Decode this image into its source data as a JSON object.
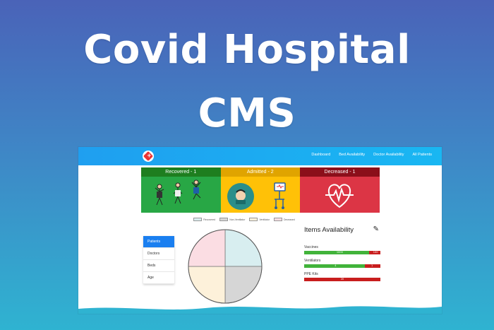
{
  "headline": {
    "line1": "Covid Hospital",
    "line2": "CMS"
  },
  "nav": {
    "logo_icon": "heart-cross-icon",
    "links": [
      "Dashboard",
      "Bed Availability",
      "Doctor Availability",
      "All Patients"
    ]
  },
  "cards": [
    {
      "title": "Recovered - 1",
      "color": "#28a745",
      "icon": "people-jumping-icon"
    },
    {
      "title": "Admitted - 2",
      "color": "#ffc107",
      "icon": "patient-ventilator-icon"
    },
    {
      "title": "Decreased - 1",
      "color": "#dc3545",
      "icon": "heartbeat-icon"
    }
  ],
  "legend": [
    "Recovered",
    "Non-Ventilator",
    "Ventilator",
    "Deceased"
  ],
  "side_menu": {
    "items": [
      "Patients",
      "Doctors",
      "Beds",
      "Age"
    ],
    "active": "Patients"
  },
  "items_availability": {
    "title": "Items Availability",
    "rows": [
      {
        "label": "Vaccines",
        "available": 85,
        "unavailable": 15,
        "available_text": "1000",
        "unavailable_text": "100"
      },
      {
        "label": "Ventilators",
        "available": 80,
        "unavailable": 20,
        "available_text": "4",
        "unavailable_text": "1"
      },
      {
        "label": "PPE Kits",
        "available": 0,
        "unavailable": 100,
        "available_text": "",
        "unavailable_text": "20"
      }
    ]
  },
  "chart_data": {
    "type": "pie",
    "categories": [
      "Recovered",
      "Non-Ventilator",
      "Ventilator",
      "Deceased"
    ],
    "values": [
      1,
      1,
      1,
      1
    ],
    "colors": [
      "#d8eef0",
      "#d6d6d6",
      "#fdf1da",
      "#fbdde3"
    ]
  }
}
